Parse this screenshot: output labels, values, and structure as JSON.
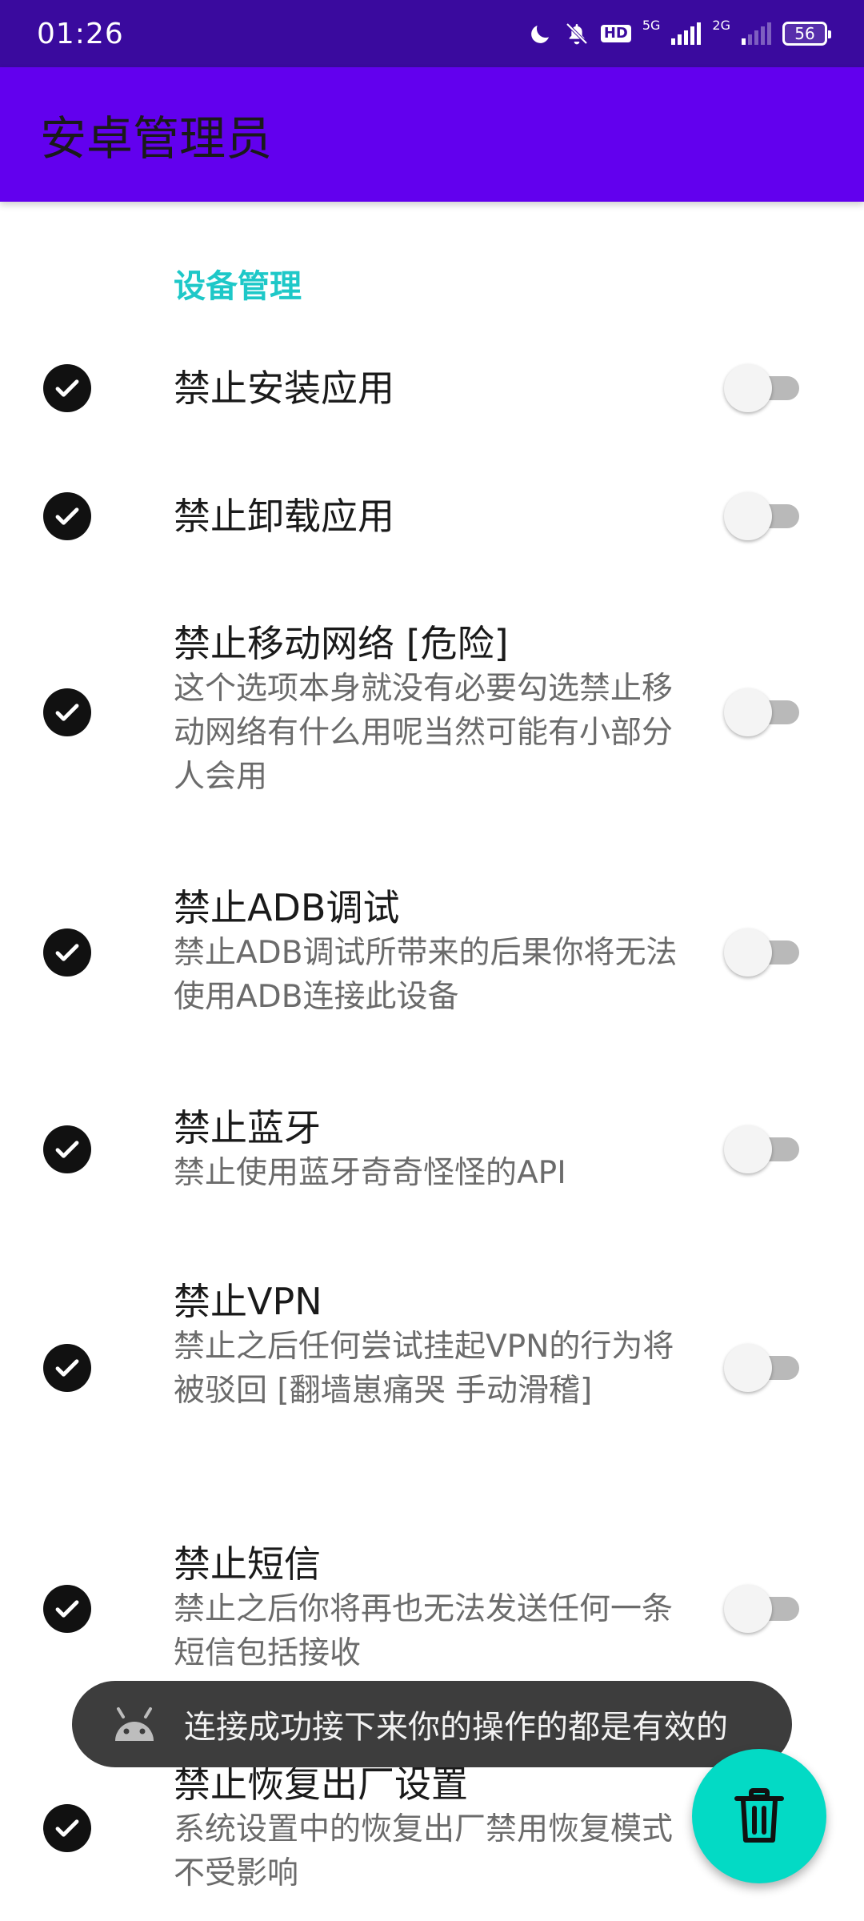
{
  "status_bar": {
    "time": "01:26",
    "hd_label": "HD",
    "net1_label": "5G",
    "net2_label": "2G",
    "battery": "56"
  },
  "app_bar": {
    "title": "安卓管理员"
  },
  "section": {
    "title": "设备管理"
  },
  "preferences": [
    {
      "title": "禁止安装应用",
      "summary": "",
      "checked": true,
      "switch_on": false
    },
    {
      "title": "禁止卸载应用",
      "summary": "",
      "checked": true,
      "switch_on": false
    },
    {
      "title": "禁止移动网络 [危险]",
      "summary": "这个选项本身就没有必要勾选禁止移动网络有什么用呢当然可能有小部分人会用",
      "checked": true,
      "switch_on": false
    },
    {
      "title": "禁止ADB调试",
      "summary": "禁止ADB调试所带来的后果你将无法使用ADB连接此设备",
      "checked": true,
      "switch_on": false
    },
    {
      "title": "禁止蓝牙",
      "summary": "禁止使用蓝牙奇奇怪怪的API",
      "checked": true,
      "switch_on": false
    },
    {
      "title": "禁止VPN",
      "summary": "禁止之后任何尝试挂起VPN的行为将被驳回 [翻墙崽痛哭 手动滑稽]",
      "checked": true,
      "switch_on": false
    },
    {
      "title": "禁止短信",
      "summary": "禁止之后你将再也无法发送任何一条短信包括接收",
      "checked": true,
      "switch_on": false
    },
    {
      "title": "禁止恢复出厂设置",
      "summary": "系统设置中的恢复出厂禁用恢复模式不受影响",
      "checked": true,
      "switch_on": false
    }
  ],
  "toast": {
    "message": "连接成功接下来你的操作的都是有效的",
    "icon": "android-icon"
  },
  "fab": {
    "icon": "trash-icon"
  },
  "colors": {
    "status_bar": "#3a0a9e",
    "app_bar": "#6200ee",
    "accent": "#1ec8c8",
    "fab": "#03dac5"
  }
}
